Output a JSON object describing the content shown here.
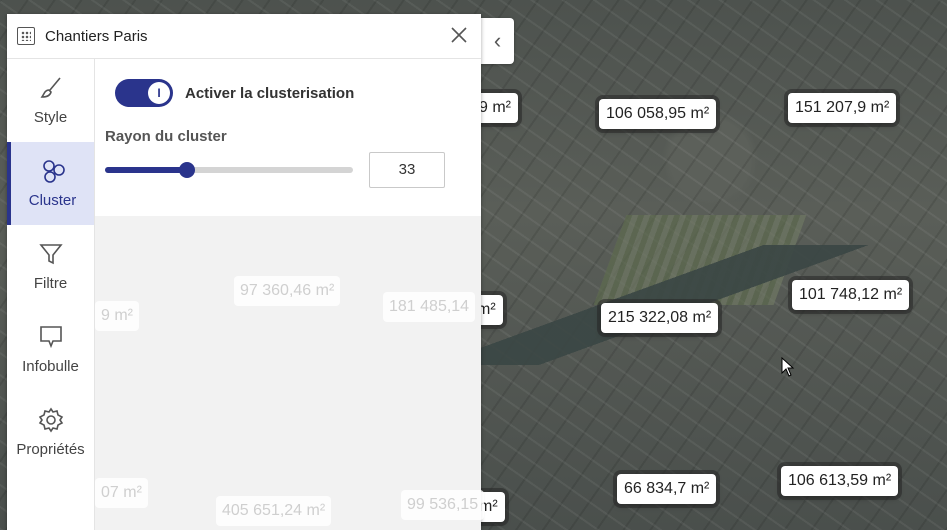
{
  "panel": {
    "title": "Chantiers Paris"
  },
  "sidebar": {
    "items": [
      {
        "label": "Style",
        "icon": "brush-icon"
      },
      {
        "label": "Cluster",
        "icon": "cluster-icon"
      },
      {
        "label": "Filtre",
        "icon": "funnel-icon"
      },
      {
        "label": "Infobulle",
        "icon": "speech-bubble-icon"
      },
      {
        "label": "Propriétés",
        "icon": "gear-icon"
      }
    ]
  },
  "cluster_settings": {
    "toggle_label": "Activer la clusterisation",
    "toggle_state": "I",
    "radius_label": "Rayon du cluster",
    "radius_value": "33",
    "radius_percent": 33
  },
  "map_clusters": [
    "9 m²",
    "106 058,95 m²",
    "151 207,9 m²",
    "215 322,08 m²",
    "101 748,12 m²",
    "66 834,7 m²",
    "106 613,59 m²",
    " m²",
    " m²"
  ],
  "ghost_clusters": [
    "97 360,46 m²",
    "181 485,14",
    "9 m²",
    "07 m²",
    "405 651,24 m²",
    "99 536,15"
  ]
}
